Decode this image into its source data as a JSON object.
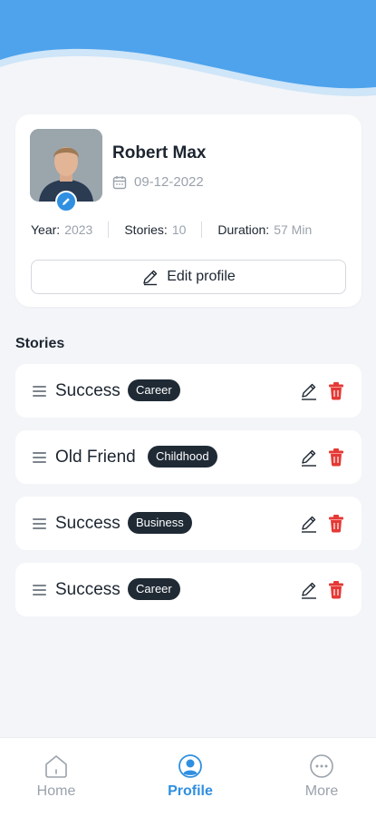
{
  "colors": {
    "accent": "#2f8fe0",
    "tag_bg": "#1f2a35",
    "delete": "#e53935",
    "wave_dark": "#4ea3ec",
    "wave_light": "#cfe5f8"
  },
  "profile": {
    "name": "Robert Max",
    "date": "09-12-2022",
    "stats": [
      {
        "key": "Year:",
        "value": "2023"
      },
      {
        "key": "Stories:",
        "value": "10"
      },
      {
        "key": "Duration:",
        "value": "57 Min"
      }
    ],
    "edit_label": "Edit profile"
  },
  "stories_title": "Stories",
  "stories": [
    {
      "title": "Success",
      "tag": "Career"
    },
    {
      "title": "Old Friend",
      "tag": "Childhood"
    },
    {
      "title": "Success",
      "tag": "Business"
    },
    {
      "title": "Success",
      "tag": "Career"
    }
  ],
  "nav": [
    {
      "label": "Home",
      "icon": "home-icon",
      "active": false
    },
    {
      "label": "Profile",
      "icon": "profile-icon",
      "active": true
    },
    {
      "label": "More",
      "icon": "more-icon",
      "active": false
    }
  ]
}
